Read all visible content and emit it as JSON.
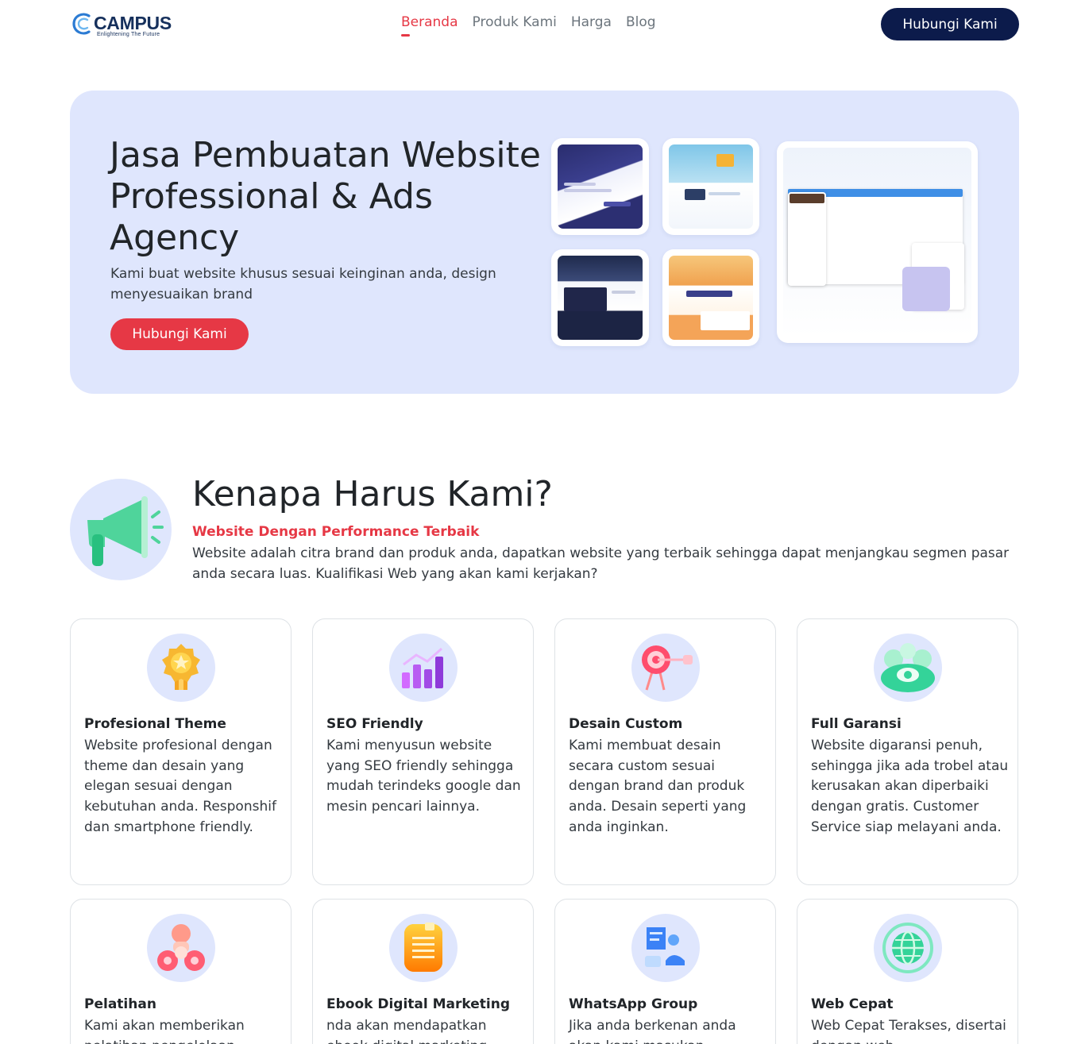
{
  "nav": {
    "logo_text": "CAMPUS",
    "logo_tagline": "Enlightening The Future",
    "links": [
      {
        "label": "Beranda",
        "active": true
      },
      {
        "label": "Produk Kami",
        "active": false
      },
      {
        "label": "Harga",
        "active": false
      },
      {
        "label": "Blog",
        "active": false
      }
    ],
    "cta_label": "Hubungi Kami"
  },
  "hero": {
    "title": "Jasa Pembuatan Website Professional & Ads Agency",
    "subtitle": "Kami buat website khusus sesuai keinginan anda, design menyesuaikan brand",
    "cta_label": "Hubungi Kami"
  },
  "why": {
    "icon": "megaphone-icon",
    "title": "Kenapa Harus Kami?",
    "subtitle": "Website Dengan Performance Terbaik",
    "description": "Website adalah citra brand dan produk anda, dapatkan website yang terbaik sehingga dapat menjangkau segmen pasar anda secara luas. Kualifikasi Web yang akan kami kerjakan?"
  },
  "features": [
    {
      "icon": "medal-icon",
      "title": "Profesional Theme",
      "desc": "Website profesional dengan theme dan desain yang elegan sesuai dengan kebutuhan anda. Responshif dan smartphone friendly."
    },
    {
      "icon": "chart-icon",
      "title": "SEO Friendly",
      "desc": "Kami menyusun website yang SEO friendly sehingga mudah terindeks google dan mesin pencari lainnya."
    },
    {
      "icon": "target-icon",
      "title": "Desain Custom",
      "desc": "Kami membuat desain secara custom sesuai dengan brand dan produk anda. Desain seperti yang anda inginkan."
    },
    {
      "icon": "money-icon",
      "title": "Full Garansi",
      "desc": "Website digaransi penuh, sehingga jika ada trobel atau kerusakan akan diperbaiki dengan gratis. Customer Service siap melayani anda."
    },
    {
      "icon": "people-icon",
      "title": "Pelatihan",
      "desc": "Kami akan memberikan pelatihan pengelolaan"
    },
    {
      "icon": "ebook-icon",
      "title": "Ebook Digital Marketing",
      "desc": "nda akan mendapatkan ebook digital marketing"
    },
    {
      "icon": "chat-icon",
      "title": "WhatsApp Group",
      "desc": "Jika anda berkenan anda akan kami masukan"
    },
    {
      "icon": "globe-icon",
      "title": "Web Cepat",
      "desc": "Web Cepat Terakses, disertai dengan web"
    }
  ],
  "colors": {
    "accent": "#e63845",
    "navy": "#0c1b4b",
    "hero_bg": "#dfe6fd",
    "text": "#212529"
  }
}
